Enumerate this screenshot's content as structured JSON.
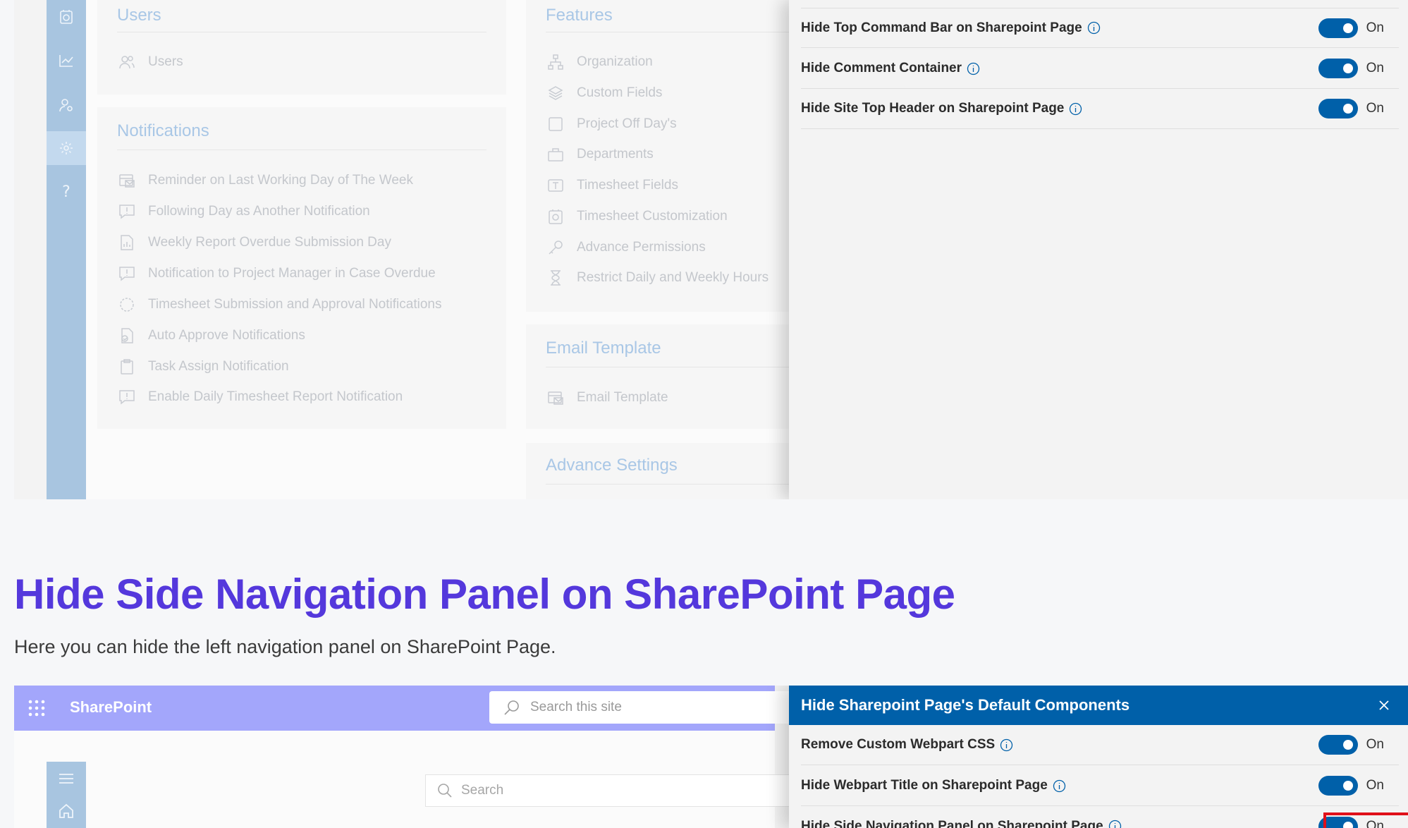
{
  "top_screenshot": {
    "rail_icons": [
      "timesheet-icon",
      "chart-icon",
      "user-settings-icon",
      "gear-icon",
      "help-icon"
    ],
    "rail_help_glyph": "?",
    "users_card": {
      "title": "Users",
      "items": [
        {
          "label": "Users",
          "icon": "users-icon"
        }
      ]
    },
    "notifications_card": {
      "title": "Notifications",
      "items": [
        {
          "label": "Reminder on Last Working Day of The Week",
          "icon": "mail-calendar-icon"
        },
        {
          "label": "Following Day as Another Notification",
          "icon": "comment-alert-icon"
        },
        {
          "label": "Weekly Report Overdue Submission Day",
          "icon": "report-icon"
        },
        {
          "label": "Notification to Project Manager in Case Overdue",
          "icon": "comment-alert-icon"
        },
        {
          "label": "Timesheet Submission and Approval Notifications",
          "icon": "cycle-icon"
        },
        {
          "label": "Auto Approve Notifications",
          "icon": "document-check-icon"
        },
        {
          "label": "Task Assign Notification",
          "icon": "clipboard-icon"
        },
        {
          "label": "Enable Daily Timesheet Report Notification",
          "icon": "comment-alert-icon"
        }
      ]
    },
    "features_card": {
      "title": "Features",
      "items": [
        {
          "label": "Organization",
          "icon": "org-chart-icon"
        },
        {
          "label": "Custom Fields",
          "icon": "layers-icon"
        },
        {
          "label": "Project Off Day's",
          "icon": "square-icon"
        },
        {
          "label": "Departments",
          "icon": "briefcase-icon"
        },
        {
          "label": "Timesheet Fields",
          "icon": "text-field-icon"
        },
        {
          "label": "Timesheet Customization",
          "icon": "timesheet-gear-icon"
        },
        {
          "label": "Advance Permissions",
          "icon": "key-icon"
        },
        {
          "label": "Restrict Daily and Weekly Hours",
          "icon": "hourglass-icon"
        }
      ]
    },
    "email_card": {
      "title": "Email Template",
      "items": [
        {
          "label": "Email Template",
          "icon": "mail-calendar-icon"
        }
      ]
    },
    "advance_card": {
      "title": "Advance Settings"
    },
    "panel_rows": [
      {
        "label": "Hide Top Command Bar on Sharepoint Page",
        "state": "On"
      },
      {
        "label": "Hide Comment Container",
        "state": "On"
      },
      {
        "label": "Hide Site Top Header on Sharepoint Page",
        "state": "On"
      }
    ]
  },
  "article": {
    "heading": "Hide Side Navigation Panel on SharePoint Page",
    "description": "Here you can hide the left navigation panel on SharePoint Page."
  },
  "bottom_screenshot": {
    "app_name": "SharePoint",
    "site_search_placeholder": "Search this site",
    "inner_search_placeholder": "Search",
    "rail_icons": [
      "menu-icon",
      "home-icon"
    ],
    "panel_title": "Hide Sharepoint Page's Default Components",
    "panel_rows": [
      {
        "label": "Remove Custom Webpart CSS",
        "state": "On"
      },
      {
        "label": "Hide Webpart Title on Sharepoint Page",
        "state": "On"
      },
      {
        "label": "Hide Side Navigation Panel on Sharepoint Page",
        "state": "On"
      }
    ]
  },
  "colors": {
    "heading": "#5438dc",
    "panel_header": "#0060a9",
    "toggle_on": "#0060a9",
    "highlight": "#e0101a",
    "rail": "#a8c5e0",
    "sharepoint_bar": "#a3a6fb"
  }
}
